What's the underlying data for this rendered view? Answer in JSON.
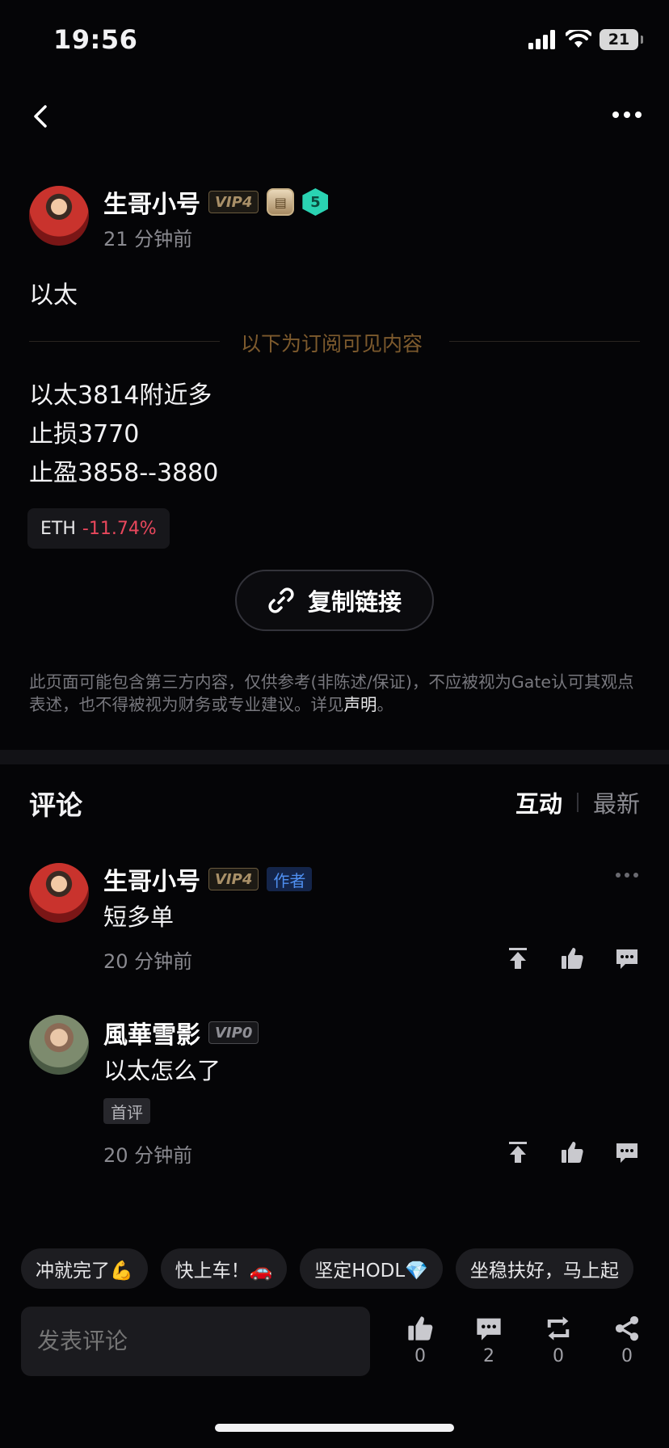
{
  "status_bar": {
    "time": "19:56",
    "battery": "21"
  },
  "post": {
    "author": "生哥小号",
    "vip": "VIP4",
    "level_badge": "5",
    "time": "21 分钟前",
    "title": "以太",
    "subscribe_label": "以下为订阅可见内容",
    "lines": [
      "以太3814附近多",
      "止损3770",
      "止盈3858--3880"
    ],
    "token": {
      "symbol": "ETH",
      "change": "-11.74%"
    },
    "copy_link": "复制链接",
    "disclaimer": "此页面可能包含第三方内容，仅供参考(非陈述/保证)，不应被视为Gate认可其观点表述，也不得被视为财务或专业建议。详见",
    "disclaimer_link": "声明",
    "disclaimer_end": "。"
  },
  "comments_section": {
    "title": "评论",
    "sort": {
      "active": "互动",
      "inactive": "最新"
    },
    "items": [
      {
        "author": "生哥小号",
        "vip": "VIP4",
        "tag": "作者",
        "text": "短多单",
        "time": "20 分钟前"
      },
      {
        "author": "風華雪影",
        "vip": "VIP0",
        "tag": "首评",
        "text": "以太怎么了",
        "time": "20 分钟前"
      }
    ]
  },
  "quick_replies": [
    "冲就完了💪",
    "快上车！🚗",
    "坚定HODL💎",
    "坐稳扶好，马上起"
  ],
  "bottom_bar": {
    "placeholder": "发表评论",
    "likes": "0",
    "comments": "2",
    "reposts": "0",
    "shares": "0"
  },
  "colors": {
    "accent_red": "#e8475c",
    "author_tag": "#4f8ff0",
    "subscribe_gold": "#7d5a2d"
  }
}
